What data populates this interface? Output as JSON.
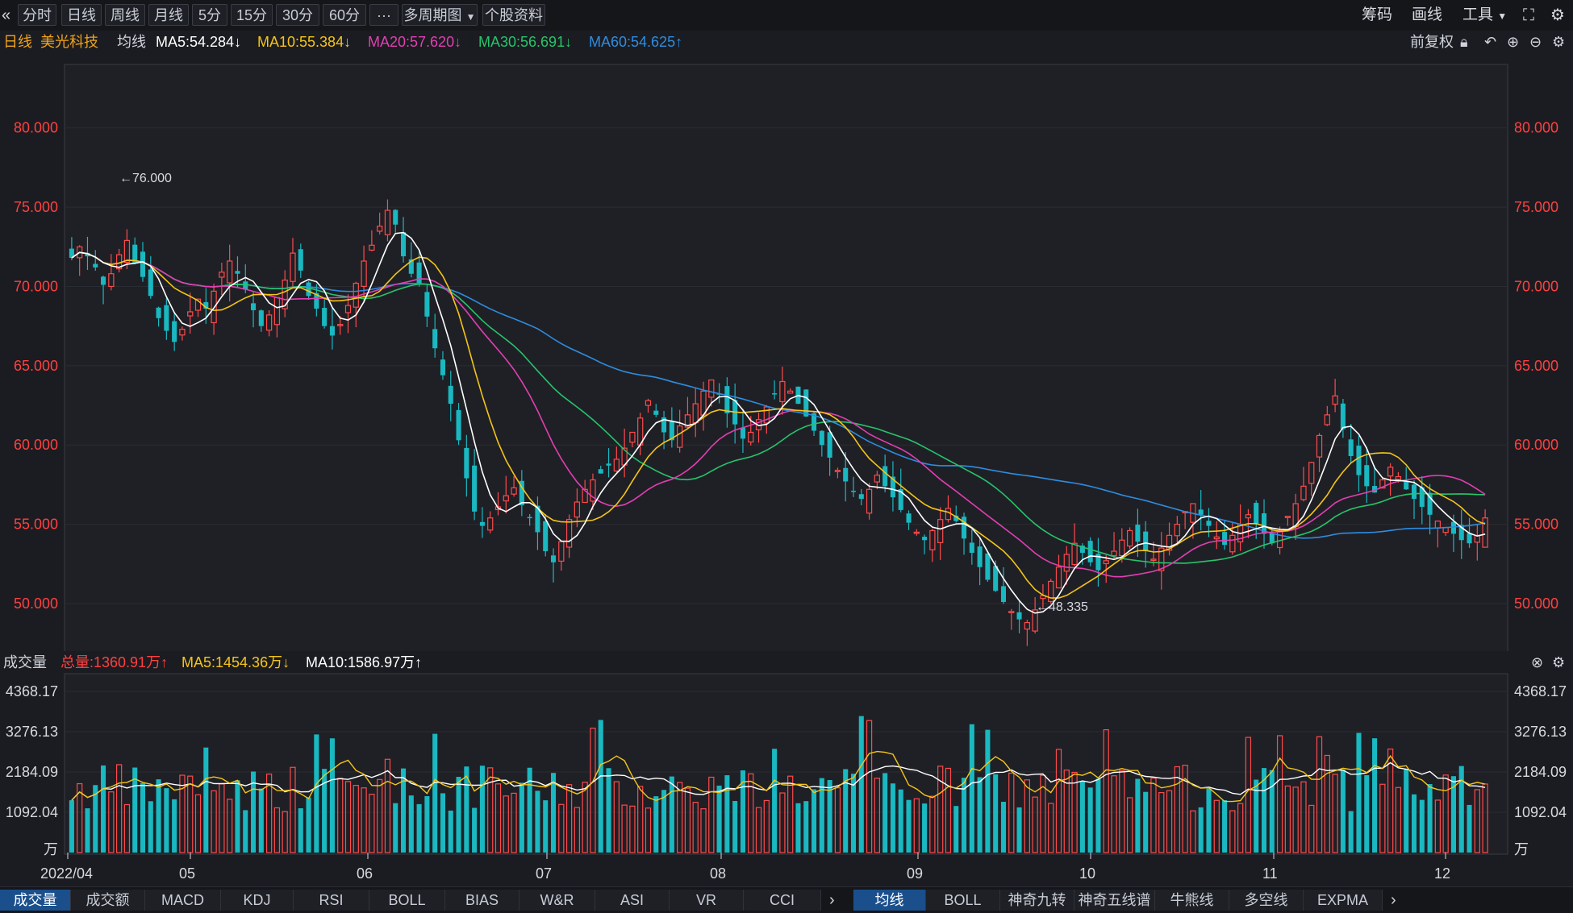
{
  "toolbar": {
    "collapse_glyph": "«",
    "tabs": [
      {
        "label": "分时",
        "active": false
      },
      {
        "label": "日线",
        "active": true
      },
      {
        "label": "周线",
        "active": false
      },
      {
        "label": "月线",
        "active": false
      },
      {
        "label": "5分",
        "active": false
      },
      {
        "label": "15分",
        "active": false
      },
      {
        "label": "30分",
        "active": false
      },
      {
        "label": "60分",
        "active": false
      }
    ],
    "more_label": "···",
    "multi_period_label": "多周期图",
    "profile_label": "个股资料",
    "right": {
      "chips_label": "筹码",
      "draw_label": "画线",
      "tools_label": "工具"
    }
  },
  "infobar": {
    "period": "日线",
    "stock_name": "美光科技",
    "ma_label": "均线",
    "ma": [
      {
        "text": "MA5:54.284",
        "dir": "down",
        "color": "#ffffff"
      },
      {
        "text": "MA10:55.384",
        "dir": "down",
        "color": "#f5c518"
      },
      {
        "text": "MA20:57.620",
        "dir": "down",
        "color": "#e23fb2"
      },
      {
        "text": "MA30:56.691",
        "dir": "down",
        "color": "#27c46b"
      },
      {
        "text": "MA60:54.625",
        "dir": "up",
        "color": "#2e8de0"
      }
    ],
    "adjust_label": "前复权"
  },
  "volume_info": {
    "title": "成交量",
    "total": {
      "text": "总量:1360.91万",
      "dir": "up",
      "color": "#ff4040"
    },
    "ma5": {
      "text": "MA5:1454.36万",
      "dir": "down",
      "color": "#f5c518"
    },
    "ma10": {
      "text": "MA10:1586.97万",
      "dir": "up",
      "color": "#ffffff"
    }
  },
  "chart_data": {
    "type": "candlestick",
    "price_axis": {
      "ticks": [
        "80.000",
        "75.000",
        "70.000",
        "65.000",
        "60.000",
        "55.000",
        "50.000"
      ],
      "range": [
        47,
        84
      ]
    },
    "volume_axis": {
      "ticks": [
        "4368.17",
        "3276.13",
        "2184.09",
        "1092.04"
      ],
      "unit": "万",
      "range": [
        0,
        4368.17
      ]
    },
    "x_labels": [
      "2022/04",
      "05",
      "06",
      "07",
      "08",
      "09",
      "10",
      "11",
      "12"
    ],
    "annotations": {
      "high": "←76.000",
      "low": "←48.335"
    },
    "colors": {
      "up": "#ff4a4a",
      "down": "#1ab8c0",
      "ma5": "#ffffff",
      "ma10": "#f5c518",
      "ma20": "#e23fb2",
      "ma30": "#27c46b",
      "ma60": "#2e8de0",
      "grid": "#2a2c33",
      "axis_text": "#ff4040"
    },
    "closes": [
      71.8,
      72.5,
      71.9,
      71.2,
      70.1,
      70.8,
      72.0,
      72.9,
      71.5,
      70.6,
      69.4,
      68.0,
      67.2,
      66.5,
      67.3,
      68.4,
      69.2,
      68.6,
      69.7,
      70.9,
      71.6,
      70.8,
      69.8,
      68.5,
      67.5,
      68.2,
      69.3,
      70.4,
      72.1,
      71.0,
      69.4,
      68.6,
      67.5,
      66.9,
      67.6,
      68.8,
      70.2,
      71.6,
      72.6,
      73.8,
      74.8,
      73.9,
      71.9,
      70.8,
      70.1,
      68.1,
      66.1,
      64.4,
      62.6,
      60.3,
      57.9,
      55.8,
      54.9,
      55.4,
      56.1,
      56.8,
      57.3,
      56.2,
      55.4,
      54.5,
      53.3,
      52.6,
      53.9,
      55.3,
      56.4,
      57.2,
      57.8,
      58.2,
      58.7,
      59.1,
      59.8,
      60.8,
      61.7,
      62.8,
      61.9,
      60.8,
      60.3,
      61.2,
      61.9,
      62.6,
      63.4,
      64.1,
      63.2,
      62.0,
      61.3,
      60.4,
      60.8,
      61.6,
      62.4,
      63.2,
      64.0,
      63.4,
      62.6,
      61.8,
      60.9,
      60.0,
      59.2,
      58.4,
      57.7,
      57.1,
      56.6,
      57.2,
      58.1,
      57.4,
      56.7,
      55.9,
      55.1,
      54.5,
      54.0,
      54.6,
      55.3,
      56.0,
      55.2,
      54.1,
      53.2,
      52.3,
      51.5,
      50.8,
      50.1,
      49.5,
      49.0,
      48.8,
      49.6,
      50.5,
      51.4,
      52.3,
      53.1,
      53.8,
      53.2,
      52.6,
      52.1,
      52.7,
      53.3,
      54.0,
      54.6,
      53.9,
      53.3,
      52.8,
      53.5,
      54.3,
      55.0,
      55.8,
      56.3,
      55.6,
      54.9,
      54.2,
      53.7,
      54.3,
      55.0,
      55.6,
      55.0,
      54.4,
      53.8,
      54.6,
      55.5,
      56.3,
      57.4,
      58.9,
      60.6,
      61.9,
      63.1,
      61.0,
      59.3,
      58.1,
      57.4,
      57.0,
      57.8,
      58.6,
      58.0,
      57.2,
      56.6,
      56.1,
      55.6,
      55.2,
      54.8,
      54.4,
      54.0,
      53.8,
      54.3,
      55.4
    ]
  }
}
